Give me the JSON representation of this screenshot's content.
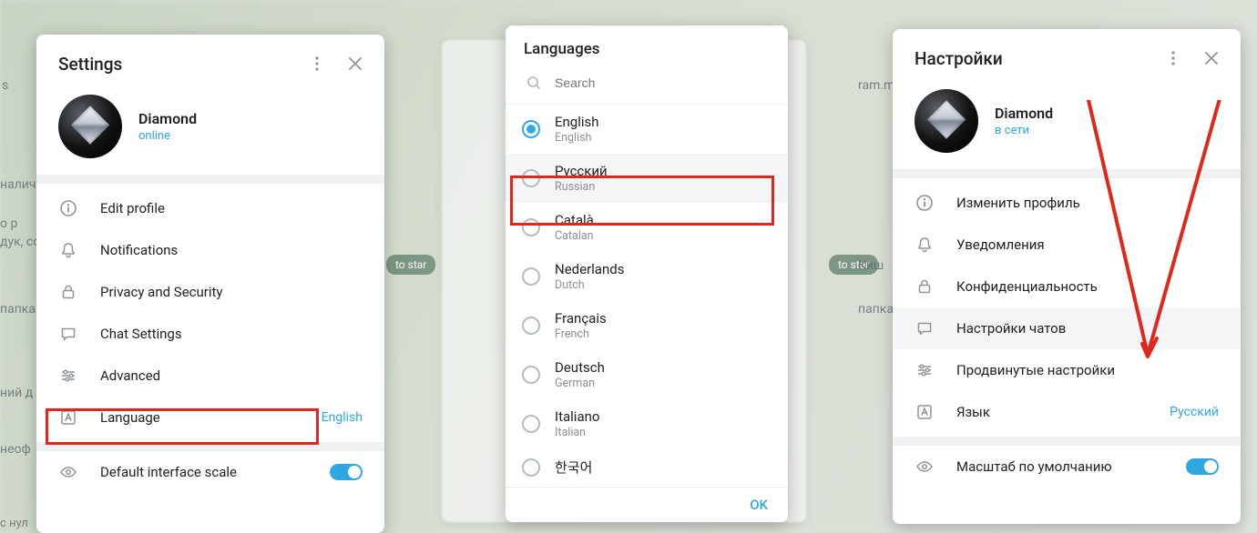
{
  "panel1": {
    "title": "Settings",
    "profile": {
      "name": "Diamond",
      "status": "online"
    },
    "menu": [
      {
        "key": "edit-profile",
        "label": "Edit profile"
      },
      {
        "key": "notifications",
        "label": "Notifications"
      },
      {
        "key": "privacy",
        "label": "Privacy and Security"
      },
      {
        "key": "chat-settings",
        "label": "Chat Settings"
      },
      {
        "key": "advanced",
        "label": "Advanced"
      },
      {
        "key": "language",
        "label": "Language",
        "value": "English"
      }
    ],
    "scale_label": "Default interface scale"
  },
  "panel2": {
    "title": "Languages",
    "search_placeholder": "Search",
    "languages": [
      {
        "native": "English",
        "eng": "English",
        "selected": true
      },
      {
        "native": "Русский",
        "eng": "Russian",
        "highlighted": true
      },
      {
        "native": "Català",
        "eng": "Catalan"
      },
      {
        "native": "Nederlands",
        "eng": "Dutch"
      },
      {
        "native": "Français",
        "eng": "French"
      },
      {
        "native": "Deutsch",
        "eng": "German"
      },
      {
        "native": "Italiano",
        "eng": "Italian"
      },
      {
        "native": "한국어",
        "eng": ""
      }
    ],
    "ok_label": "OK"
  },
  "panel3": {
    "title": "Настройки",
    "profile": {
      "name": "Diamond",
      "status": "в сети"
    },
    "menu": [
      {
        "key": "edit-profile",
        "label": "Изменить профиль"
      },
      {
        "key": "notifications",
        "label": "Уведомления"
      },
      {
        "key": "privacy",
        "label": "Конфиденциальность"
      },
      {
        "key": "chat-settings",
        "label": "Настройки чатов",
        "highlighted": true
      },
      {
        "key": "advanced",
        "label": "Продвинутые настройки"
      },
      {
        "key": "language",
        "label": "Язык",
        "value": "Русский"
      }
    ],
    "scale_label": "Масштаб по умолчанию"
  },
  "annotation_color": "#e1261c",
  "background_fragments": {
    "to_start": "to star",
    "s": "s",
    "op": "о р",
    "nalich": "налич",
    "papka": "папка",
    "niyd": "ний д",
    "neof": "неоф",
    "sduk": "дук, со",
    "ram": "ram.m",
    "kish": "Киш",
    "nul": "с нул"
  }
}
